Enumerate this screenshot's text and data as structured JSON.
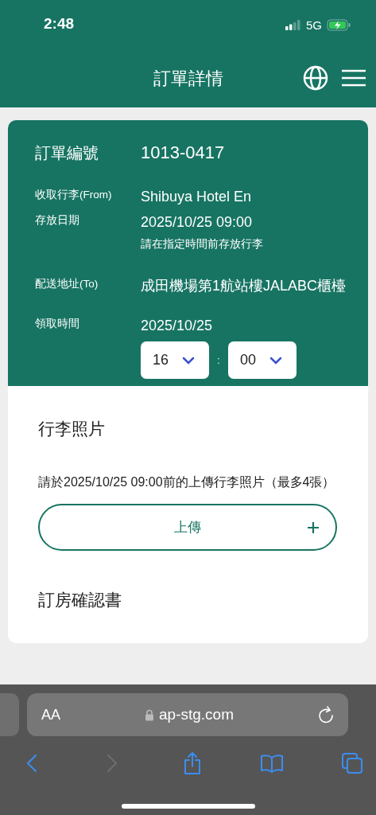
{
  "status_bar": {
    "time": "2:48",
    "network": "5G"
  },
  "header": {
    "title": "訂單詳情"
  },
  "order": {
    "number_label": "訂單編號",
    "number": "1013-0417",
    "rows": [
      {
        "label": "收取行李(From)",
        "value": "Shibuya Hotel En"
      },
      {
        "label": "存放日期",
        "value": "2025/10/25 09:00",
        "note": "請在指定時間前存放行李"
      },
      {
        "label": "配送地址(To)",
        "value": "成田機場第1航站樓JALABC櫃檯"
      }
    ],
    "pickup": {
      "label": "領取時間",
      "date": "2025/10/25",
      "hour": "16",
      "separator": ":",
      "minute": "00"
    }
  },
  "photos": {
    "title": "行李照片",
    "instructions": "請於2025/10/25 09:00前的上傳行李照片（最多4張）",
    "upload_button": "上傳"
  },
  "confirmation": {
    "title": "訂房確認書"
  },
  "browser": {
    "text_size": "AA",
    "url": "ap-stg.com",
    "nav": [
      {
        "kind": "back",
        "disabled": false
      },
      {
        "kind": "forward",
        "disabled": true
      },
      {
        "kind": "share",
        "disabled": false
      },
      {
        "kind": "bookmarks",
        "disabled": false
      },
      {
        "kind": "tabs",
        "disabled": false
      }
    ]
  }
}
